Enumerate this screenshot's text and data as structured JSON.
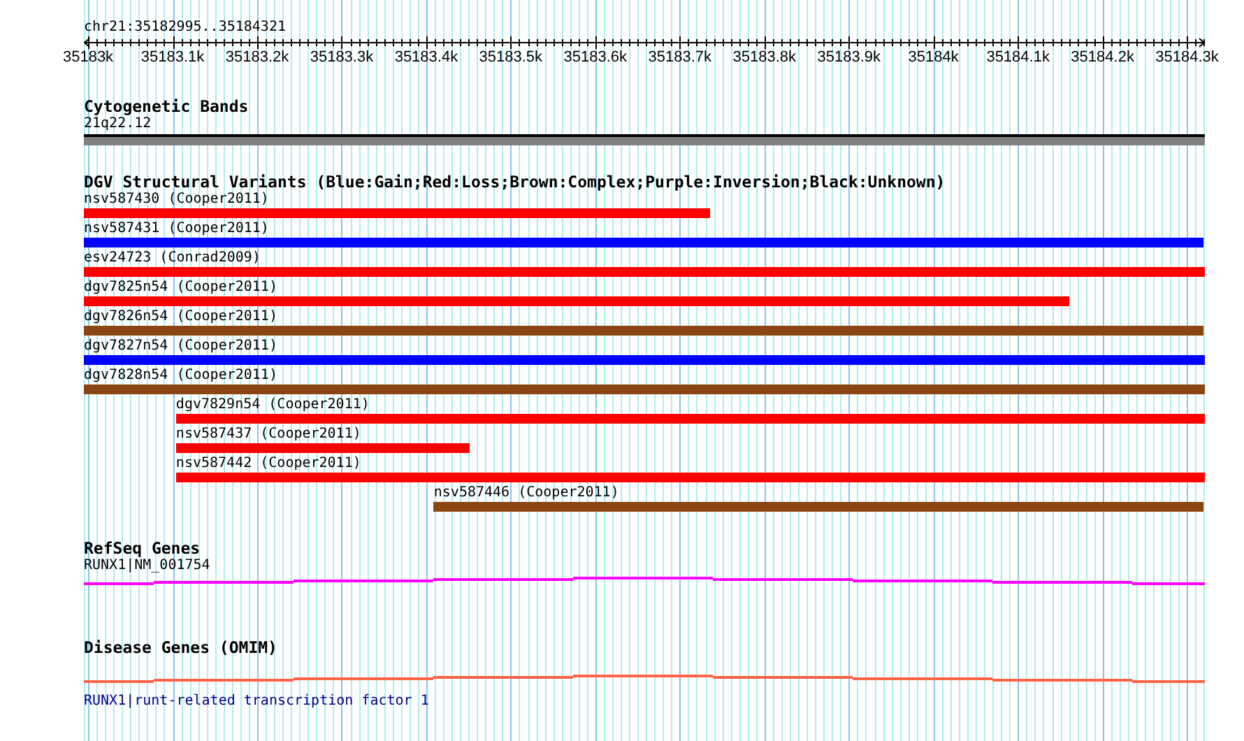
{
  "ruler": {
    "label": "chr21:35182995..35184321",
    "ticks": [
      {
        "label": "35183k"
      },
      {
        "label": "35183.1k"
      },
      {
        "label": "35183.2k"
      },
      {
        "label": "35183.3k"
      },
      {
        "label": "35183.4k"
      },
      {
        "label": "35183.5k"
      },
      {
        "label": "35183.6k"
      },
      {
        "label": "35183.7k"
      },
      {
        "label": "35183.8k"
      },
      {
        "label": "35183.9k"
      },
      {
        "label": "35184k"
      },
      {
        "label": "35184.1k"
      },
      {
        "label": "35184.2k"
      },
      {
        "label": "35184.3k"
      }
    ]
  },
  "tracks": [
    {
      "kind": "bands",
      "title": "Cytogenetic Bands",
      "features": [
        {
          "label": "21q22.12"
        }
      ]
    },
    {
      "kind": "variants",
      "title": "DGV Structural Variants (Blue:Gain;Red:Loss;Brown:Complex;Purple:Inversion;Black:Unknown)",
      "features": [
        {
          "label": "nsv587430 (Cooper2011)",
          "color": "#ff0000"
        },
        {
          "label": "nsv587431 (Cooper2011)",
          "color": "#0000ff"
        },
        {
          "label": "esv24723 (Conrad2009)",
          "color": "#ff0000"
        },
        {
          "label": "dgv7825n54 (Cooper2011)",
          "color": "#ff0000"
        },
        {
          "label": "dgv7826n54 (Cooper2011)",
          "color": "#8b4513"
        },
        {
          "label": "dgv7827n54 (Cooper2011)",
          "color": "#0000ff"
        },
        {
          "label": "dgv7828n54 (Cooper2011)",
          "color": "#8b4513"
        },
        {
          "label": "dgv7829n54 (Cooper2011)",
          "color": "#ff0000"
        },
        {
          "label": "nsv587437 (Cooper2011)",
          "color": "#ff0000"
        },
        {
          "label": "nsv587442 (Cooper2011)",
          "color": "#ff0000"
        },
        {
          "label": "nsv587446 (Cooper2011)",
          "color": "#8b4513"
        }
      ]
    },
    {
      "kind": "refseq",
      "title": "RefSeq Genes",
      "features": [
        {
          "label": "RUNX1|NM_001754"
        }
      ]
    },
    {
      "kind": "omim",
      "title": "Disease Genes (OMIM)",
      "features": [
        {
          "label": "RUNX1|runt-related transcription factor 1"
        }
      ]
    }
  ]
}
